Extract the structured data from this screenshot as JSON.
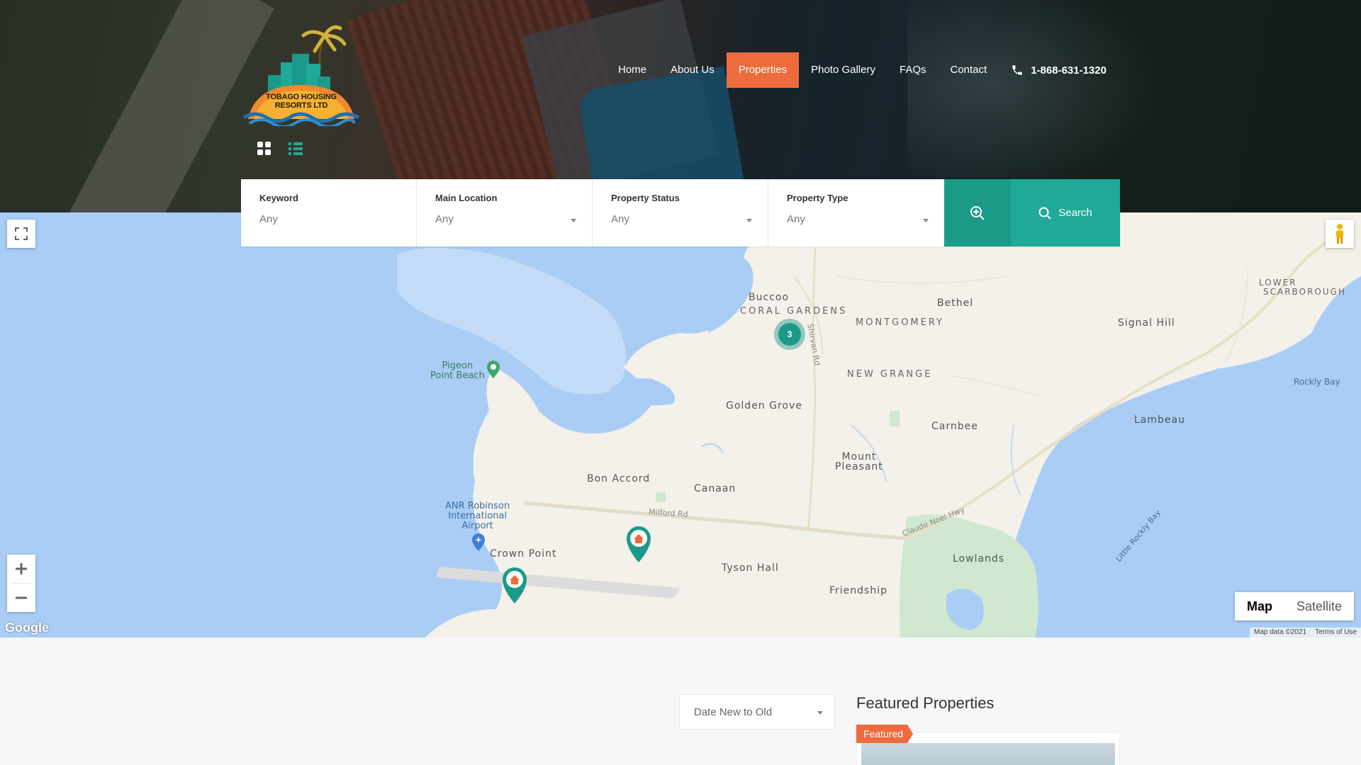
{
  "logo": {
    "alt": "TOBAGO HOUSING RESORTS LTD",
    "line1": "TOBAGO HOUSING",
    "line2": "RESORTS LTD"
  },
  "nav": {
    "items": [
      {
        "label": "Home",
        "active": false
      },
      {
        "label": "About Us",
        "active": false
      },
      {
        "label": "Properties",
        "active": true
      },
      {
        "label": "Photo Gallery",
        "active": false
      },
      {
        "label": "FAQs",
        "active": false
      },
      {
        "label": "Contact",
        "active": false
      }
    ],
    "phone": "1-868-631-1320"
  },
  "view_toggle": {
    "grid_icon": "grid-icon",
    "list_icon": "list-icon"
  },
  "search": {
    "keyword": {
      "label": "Keyword",
      "placeholder": "Any"
    },
    "main_location": {
      "label": "Main Location",
      "value": "Any"
    },
    "property_status": {
      "label": "Property Status",
      "value": "Any"
    },
    "property_type": {
      "label": "Property Type",
      "value": "Any"
    },
    "advanced_icon": "zoom-in-icon",
    "search_label": "Search"
  },
  "map": {
    "labels": {
      "buccoo": "Buccoo",
      "coral_gardens": "CORAL GARDENS",
      "montgomery": "MONTGOMERY",
      "bethel": "Bethel",
      "signal_hill": "Signal Hill",
      "lower_scarborough_1": "LOWER",
      "lower_scarborough_2": "SCARBOROUGH",
      "new_grange": "NEW GRANGE",
      "pigeon_1": "Pigeon",
      "pigeon_2": "Point Beach",
      "golden_grove": "Golden Grove",
      "carnbee": "Carnbee",
      "lambeau": "Lambeau",
      "rockly_bay": "Rockly Bay",
      "mount_1": "Mount",
      "mount_2": "Pleasant",
      "bon_accord": "Bon Accord",
      "canaan": "Canaan",
      "airport_1": "ANR Robinson",
      "airport_2": "International",
      "airport_3": "Airport",
      "crown_point": "Crown Point",
      "milford_rd": "Milford Rd",
      "tyson_hall": "Tyson Hall",
      "lowlands": "Lowlands",
      "friendship": "Friendship",
      "claude_noel": "Claude Noel Hwy",
      "shirvan_rd": "Shirvan Rd",
      "little_rockly": "Little Rockly Bay"
    },
    "cluster_count": "3",
    "type_map": "Map",
    "type_satellite": "Satellite",
    "google": "Google",
    "map_data": "Map data ©2021",
    "terms": "Terms of Use"
  },
  "sort": {
    "value": "Date New to Old"
  },
  "featured": {
    "title": "Featured Properties",
    "tag": "Featured"
  }
}
